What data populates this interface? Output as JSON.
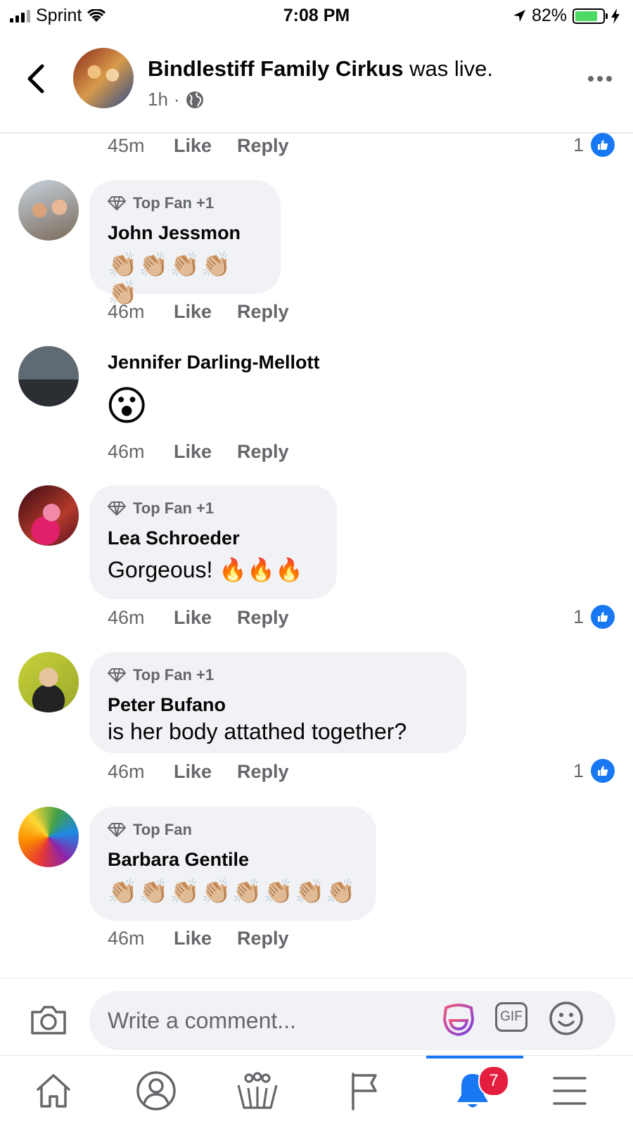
{
  "status_bar": {
    "carrier": "Sprint",
    "time": "7:08 PM",
    "battery_percent": "82%",
    "battery_level": 0.82
  },
  "header": {
    "page_name": "Bindlestiff Family Cirkus",
    "action": "was live.",
    "age": "1h",
    "separator": "·"
  },
  "comments": [
    {
      "time": "45m",
      "like_label": "Like",
      "reply_label": "Reply",
      "reactions": "1"
    },
    {
      "badge": "Top Fan +1",
      "author": "John Jessmon",
      "emoji": "👏🏼👏🏼👏🏼👏🏼👏🏼",
      "time": "46m",
      "like_label": "Like",
      "reply_label": "Reply"
    },
    {
      "author": "Jennifer Darling-Mellott",
      "emoji": "😮",
      "time": "46m",
      "like_label": "Like",
      "reply_label": "Reply"
    },
    {
      "badge": "Top Fan +1",
      "author": "Lea Schroeder",
      "text": "Gorgeous! 🔥🔥🔥",
      "time": "46m",
      "like_label": "Like",
      "reply_label": "Reply",
      "reactions": "1"
    },
    {
      "badge": "Top Fan +1",
      "author": "Peter Bufano",
      "text": "is her body attathed together?",
      "time": "46m",
      "like_label": "Like",
      "reply_label": "Reply",
      "reactions": "1"
    },
    {
      "badge": "Top Fan",
      "author": "Barbara Gentile",
      "emoji": "👏🏼👏🏼👏🏼👏🏼👏🏼👏🏼👏🏼👏🏼",
      "time": "46m",
      "like_label": "Like",
      "reply_label": "Reply"
    }
  ],
  "composer": {
    "placeholder": "Write a comment...",
    "gif_label": "GIF"
  },
  "bottom_nav": {
    "notifications_count": "7",
    "active": "notifications"
  },
  "colors": {
    "accent": "#1877f2",
    "bubble": "#f0f2f5",
    "meta": "#65676b",
    "badge": "#e41e3f"
  }
}
